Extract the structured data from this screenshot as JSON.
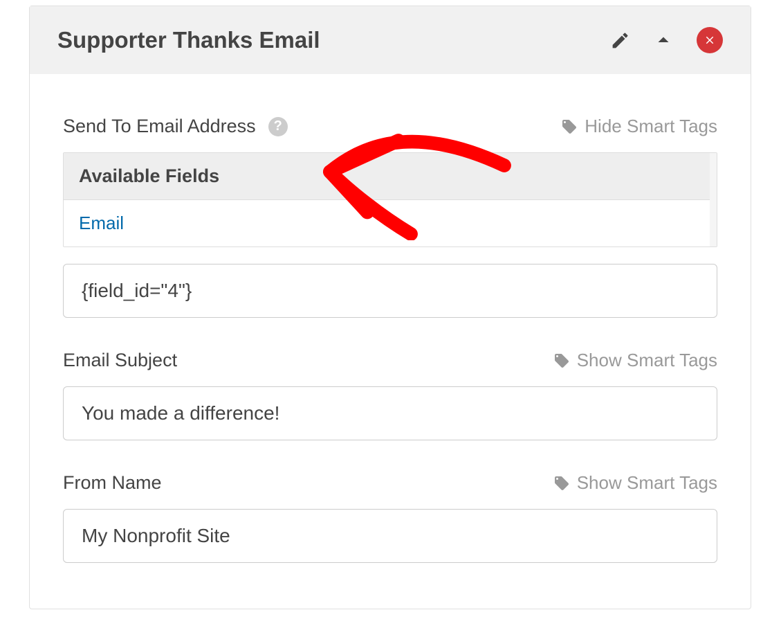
{
  "panel": {
    "title": "Supporter Thanks Email"
  },
  "sendTo": {
    "label": "Send To Email Address",
    "toggleText": "Hide Smart Tags",
    "availableHeader": "Available Fields",
    "field1": "Email",
    "value": "{field_id=\"4\"}"
  },
  "subject": {
    "label": "Email Subject",
    "toggleText": "Show Smart Tags",
    "value": "You made a difference!"
  },
  "fromName": {
    "label": "From Name",
    "toggleText": "Show Smart Tags",
    "value": "My Nonprofit Site"
  }
}
